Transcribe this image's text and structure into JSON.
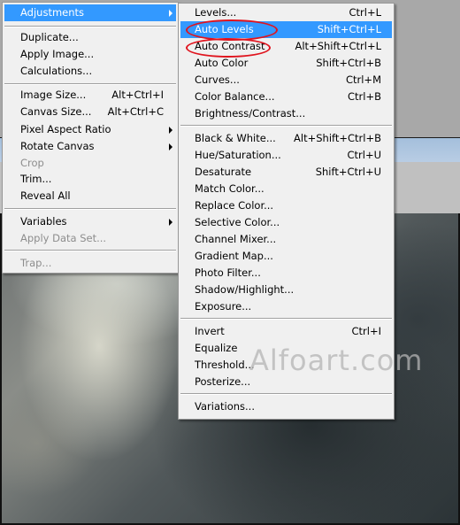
{
  "watermark": "Alfoart.com",
  "colors": {
    "highlight": "#3399ff",
    "menu_bg": "#f0f0f0",
    "annotation": "#e0141e",
    "disabled_text": "#8d8d8d"
  },
  "main_menu": {
    "items": [
      {
        "label": "Adjustments",
        "submenu": true,
        "highlighted": true
      },
      {
        "label": "Duplicate..."
      },
      {
        "label": "Apply Image..."
      },
      {
        "label": "Calculations..."
      },
      {
        "label": "Image Size...",
        "shortcut": "Alt+Ctrl+I"
      },
      {
        "label": "Canvas Size...",
        "shortcut": "Alt+Ctrl+C"
      },
      {
        "label": "Pixel Aspect Ratio",
        "submenu": true
      },
      {
        "label": "Rotate Canvas",
        "submenu": true
      },
      {
        "label": "Crop",
        "disabled": true
      },
      {
        "label": "Trim..."
      },
      {
        "label": "Reveal All"
      },
      {
        "label": "Variables",
        "submenu": true
      },
      {
        "label": "Apply Data Set...",
        "disabled": true
      },
      {
        "label": "Trap...",
        "disabled": true
      }
    ]
  },
  "adjustments_menu": {
    "items": [
      {
        "label": "Levels...",
        "shortcut": "Ctrl+L"
      },
      {
        "label": "Auto Levels",
        "shortcut": "Shift+Ctrl+L",
        "highlighted": true,
        "annotated": true
      },
      {
        "label": "Auto Contrast",
        "shortcut": "Alt+Shift+Ctrl+L",
        "annotated": true
      },
      {
        "label": "Auto Color",
        "shortcut": "Shift+Ctrl+B"
      },
      {
        "label": "Curves...",
        "shortcut": "Ctrl+M"
      },
      {
        "label": "Color Balance...",
        "shortcut": "Ctrl+B"
      },
      {
        "label": "Brightness/Contrast..."
      },
      {
        "label": "Black & White...",
        "shortcut": "Alt+Shift+Ctrl+B"
      },
      {
        "label": "Hue/Saturation...",
        "shortcut": "Ctrl+U"
      },
      {
        "label": "Desaturate",
        "shortcut": "Shift+Ctrl+U"
      },
      {
        "label": "Match Color..."
      },
      {
        "label": "Replace Color..."
      },
      {
        "label": "Selective Color..."
      },
      {
        "label": "Channel Mixer..."
      },
      {
        "label": "Gradient Map..."
      },
      {
        "label": "Photo Filter..."
      },
      {
        "label": "Shadow/Highlight..."
      },
      {
        "label": "Exposure..."
      },
      {
        "label": "Invert",
        "shortcut": "Ctrl+I"
      },
      {
        "label": "Equalize"
      },
      {
        "label": "Threshold..."
      },
      {
        "label": "Posterize..."
      },
      {
        "label": "Variations..."
      }
    ]
  }
}
